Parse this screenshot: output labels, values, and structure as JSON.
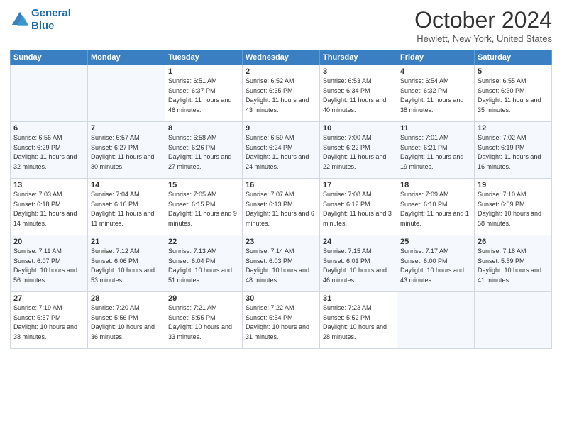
{
  "header": {
    "logo_line1": "General",
    "logo_line2": "Blue",
    "month": "October 2024",
    "location": "Hewlett, New York, United States"
  },
  "weekdays": [
    "Sunday",
    "Monday",
    "Tuesday",
    "Wednesday",
    "Thursday",
    "Friday",
    "Saturday"
  ],
  "weeks": [
    [
      {
        "day": "",
        "info": ""
      },
      {
        "day": "",
        "info": ""
      },
      {
        "day": "1",
        "info": "Sunrise: 6:51 AM\nSunset: 6:37 PM\nDaylight: 11 hours and 46 minutes."
      },
      {
        "day": "2",
        "info": "Sunrise: 6:52 AM\nSunset: 6:35 PM\nDaylight: 11 hours and 43 minutes."
      },
      {
        "day": "3",
        "info": "Sunrise: 6:53 AM\nSunset: 6:34 PM\nDaylight: 11 hours and 40 minutes."
      },
      {
        "day": "4",
        "info": "Sunrise: 6:54 AM\nSunset: 6:32 PM\nDaylight: 11 hours and 38 minutes."
      },
      {
        "day": "5",
        "info": "Sunrise: 6:55 AM\nSunset: 6:30 PM\nDaylight: 11 hours and 35 minutes."
      }
    ],
    [
      {
        "day": "6",
        "info": "Sunrise: 6:56 AM\nSunset: 6:29 PM\nDaylight: 11 hours and 32 minutes."
      },
      {
        "day": "7",
        "info": "Sunrise: 6:57 AM\nSunset: 6:27 PM\nDaylight: 11 hours and 30 minutes."
      },
      {
        "day": "8",
        "info": "Sunrise: 6:58 AM\nSunset: 6:26 PM\nDaylight: 11 hours and 27 minutes."
      },
      {
        "day": "9",
        "info": "Sunrise: 6:59 AM\nSunset: 6:24 PM\nDaylight: 11 hours and 24 minutes."
      },
      {
        "day": "10",
        "info": "Sunrise: 7:00 AM\nSunset: 6:22 PM\nDaylight: 11 hours and 22 minutes."
      },
      {
        "day": "11",
        "info": "Sunrise: 7:01 AM\nSunset: 6:21 PM\nDaylight: 11 hours and 19 minutes."
      },
      {
        "day": "12",
        "info": "Sunrise: 7:02 AM\nSunset: 6:19 PM\nDaylight: 11 hours and 16 minutes."
      }
    ],
    [
      {
        "day": "13",
        "info": "Sunrise: 7:03 AM\nSunset: 6:18 PM\nDaylight: 11 hours and 14 minutes."
      },
      {
        "day": "14",
        "info": "Sunrise: 7:04 AM\nSunset: 6:16 PM\nDaylight: 11 hours and 11 minutes."
      },
      {
        "day": "15",
        "info": "Sunrise: 7:05 AM\nSunset: 6:15 PM\nDaylight: 11 hours and 9 minutes."
      },
      {
        "day": "16",
        "info": "Sunrise: 7:07 AM\nSunset: 6:13 PM\nDaylight: 11 hours and 6 minutes."
      },
      {
        "day": "17",
        "info": "Sunrise: 7:08 AM\nSunset: 6:12 PM\nDaylight: 11 hours and 3 minutes."
      },
      {
        "day": "18",
        "info": "Sunrise: 7:09 AM\nSunset: 6:10 PM\nDaylight: 11 hours and 1 minute."
      },
      {
        "day": "19",
        "info": "Sunrise: 7:10 AM\nSunset: 6:09 PM\nDaylight: 10 hours and 58 minutes."
      }
    ],
    [
      {
        "day": "20",
        "info": "Sunrise: 7:11 AM\nSunset: 6:07 PM\nDaylight: 10 hours and 56 minutes."
      },
      {
        "day": "21",
        "info": "Sunrise: 7:12 AM\nSunset: 6:06 PM\nDaylight: 10 hours and 53 minutes."
      },
      {
        "day": "22",
        "info": "Sunrise: 7:13 AM\nSunset: 6:04 PM\nDaylight: 10 hours and 51 minutes."
      },
      {
        "day": "23",
        "info": "Sunrise: 7:14 AM\nSunset: 6:03 PM\nDaylight: 10 hours and 48 minutes."
      },
      {
        "day": "24",
        "info": "Sunrise: 7:15 AM\nSunset: 6:01 PM\nDaylight: 10 hours and 46 minutes."
      },
      {
        "day": "25",
        "info": "Sunrise: 7:17 AM\nSunset: 6:00 PM\nDaylight: 10 hours and 43 minutes."
      },
      {
        "day": "26",
        "info": "Sunrise: 7:18 AM\nSunset: 5:59 PM\nDaylight: 10 hours and 41 minutes."
      }
    ],
    [
      {
        "day": "27",
        "info": "Sunrise: 7:19 AM\nSunset: 5:57 PM\nDaylight: 10 hours and 38 minutes."
      },
      {
        "day": "28",
        "info": "Sunrise: 7:20 AM\nSunset: 5:56 PM\nDaylight: 10 hours and 36 minutes."
      },
      {
        "day": "29",
        "info": "Sunrise: 7:21 AM\nSunset: 5:55 PM\nDaylight: 10 hours and 33 minutes."
      },
      {
        "day": "30",
        "info": "Sunrise: 7:22 AM\nSunset: 5:54 PM\nDaylight: 10 hours and 31 minutes."
      },
      {
        "day": "31",
        "info": "Sunrise: 7:23 AM\nSunset: 5:52 PM\nDaylight: 10 hours and 28 minutes."
      },
      {
        "day": "",
        "info": ""
      },
      {
        "day": "",
        "info": ""
      }
    ]
  ]
}
